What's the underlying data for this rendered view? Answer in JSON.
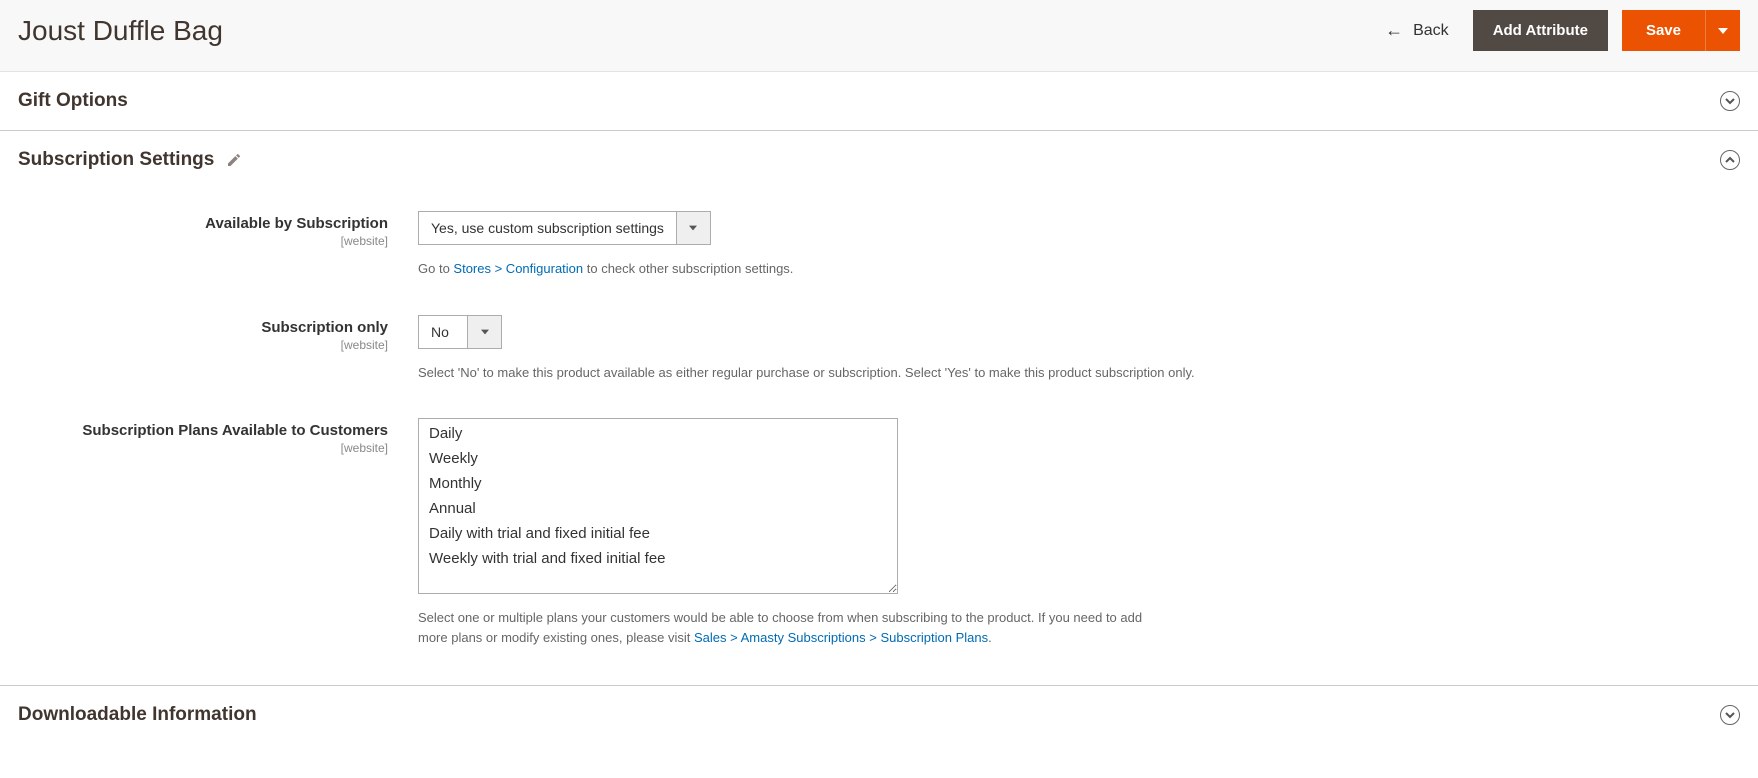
{
  "header": {
    "title": "Joust Duffle Bag",
    "back_label": "Back",
    "add_attribute_label": "Add Attribute",
    "save_label": "Save"
  },
  "sections": {
    "gift_options": {
      "title": "Gift Options"
    },
    "subscription": {
      "title": "Subscription Settings",
      "fields": {
        "available": {
          "label": "Available by Subscription",
          "scope": "[website]",
          "value": "Yes, use custom subscription settings",
          "note_prefix": "Go to ",
          "note_link": "Stores > Configuration",
          "note_suffix": " to check other subscription settings."
        },
        "only": {
          "label": "Subscription only",
          "scope": "[website]",
          "value": "No",
          "note": "Select 'No' to make this product available as either regular purchase or subscription. Select 'Yes' to make this product subscription only."
        },
        "plans": {
          "label": "Subscription Plans Available to Customers",
          "scope": "[website]",
          "options": [
            "Daily",
            "Weekly",
            "Monthly",
            "Annual",
            "Daily with trial and fixed initial fee",
            "Weekly with trial and fixed initial fee"
          ],
          "note_prefix": "Select one or multiple plans your customers would be able to choose from when subscribing to the product. If you need to add more plans or modify existing ones, please visit ",
          "note_link": "Sales > Amasty Subscriptions > Subscription Plans",
          "note_suffix": "."
        }
      }
    },
    "downloadable": {
      "title": "Downloadable Information"
    }
  }
}
